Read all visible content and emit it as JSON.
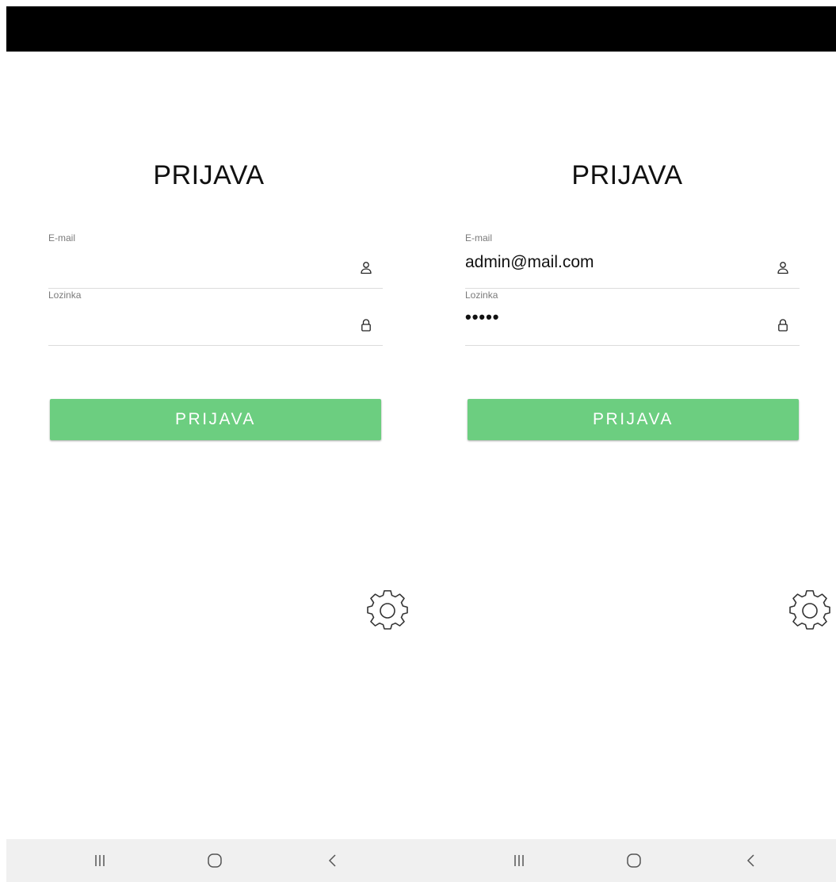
{
  "screens": [
    {
      "title": "PRIJAVA",
      "email_label": "E-mail",
      "email_value": "",
      "password_label": "Lozinka",
      "password_value": "",
      "button_label": "PRIJAVA"
    },
    {
      "title": "PRIJAVA",
      "email_label": "E-mail",
      "email_value": "admin@mail.com",
      "password_label": "Lozinka",
      "password_value": "•••••",
      "button_label": "PRIJAVA"
    }
  ],
  "icons": {
    "email": "user-icon",
    "password": "lock-icon",
    "settings": "gear-icon",
    "nav": [
      "recent-apps-icon",
      "home-icon",
      "back-icon"
    ]
  },
  "colors": {
    "button": "#6cce80",
    "top_bar": "#000000",
    "nav_bar": "#f0f0f0"
  }
}
